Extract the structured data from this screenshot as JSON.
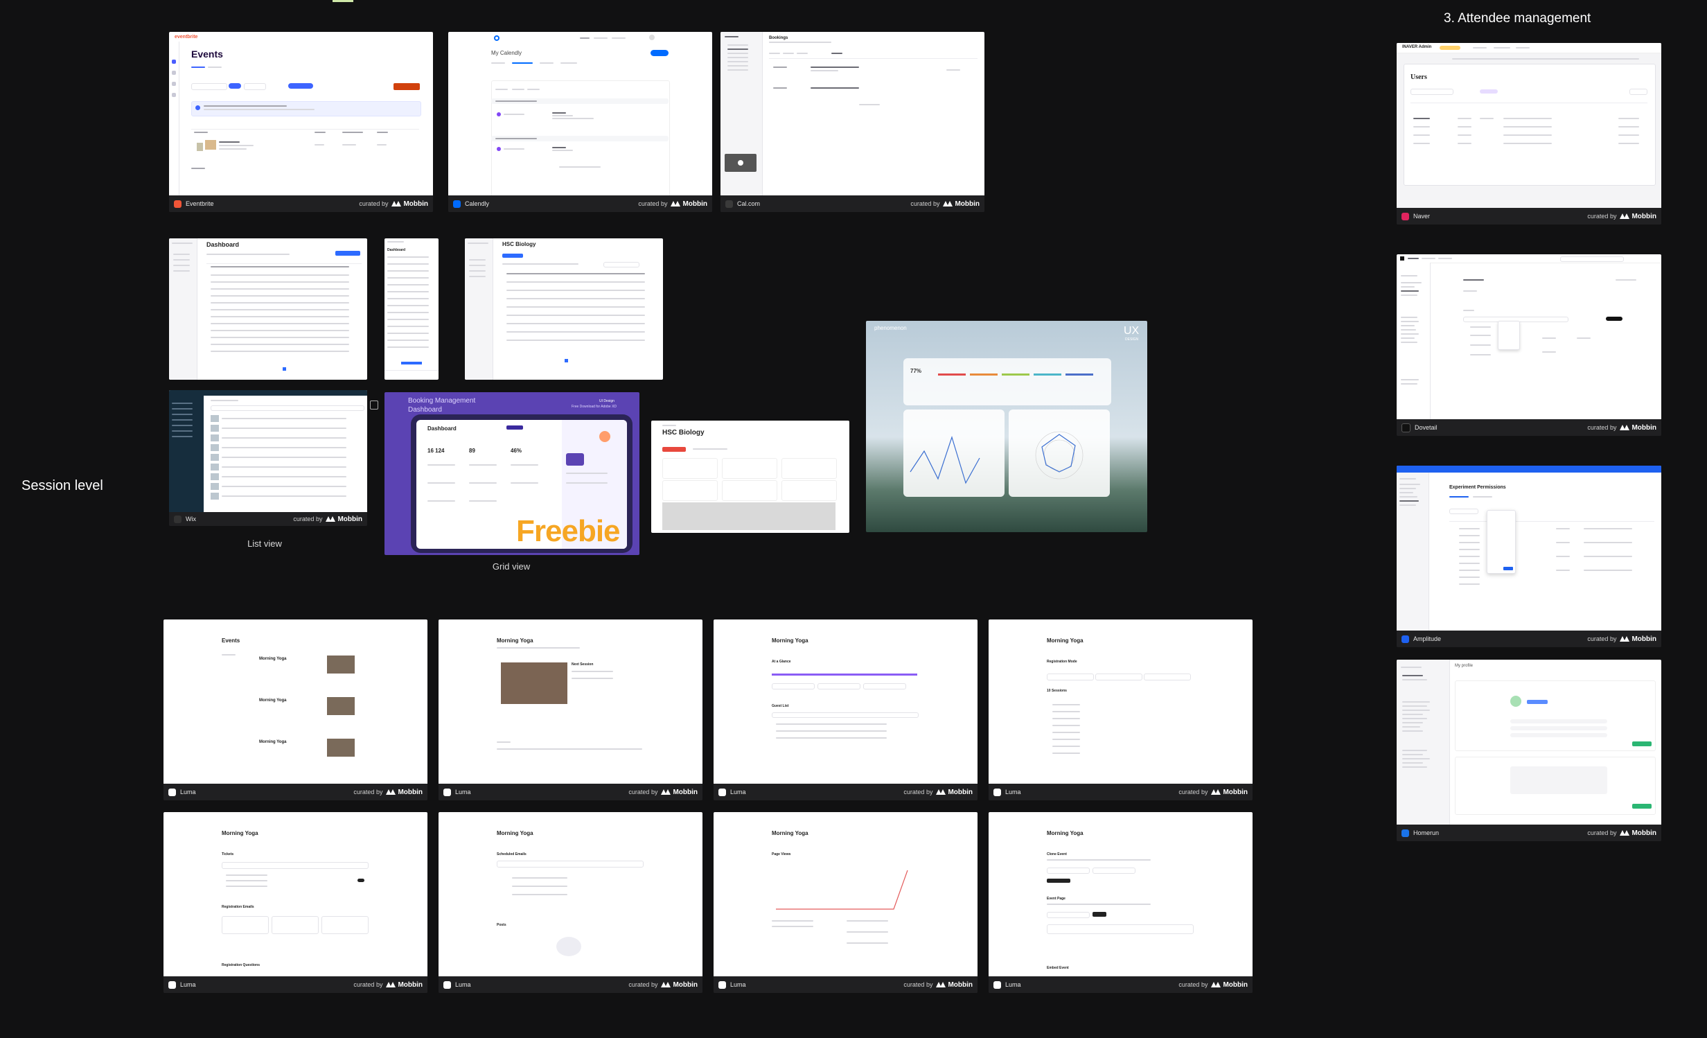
{
  "headings": {
    "attendee_management": "3. Attendee management",
    "session_level": "Session level"
  },
  "captions": {
    "list_view": "List view",
    "grid_view": "Grid view"
  },
  "footer": {
    "curated_by": "curated by",
    "brand": "Mobbin"
  },
  "cards": {
    "eventbrite": {
      "app": "Eventbrite",
      "title": "Events",
      "logo": "eventbrite",
      "app_color": "#f05537"
    },
    "calendly": {
      "app": "Calendly",
      "title": "My Calendly",
      "app_color": "#006bff"
    },
    "calcom": {
      "app": "Cal.com",
      "title": "Bookings",
      "app_color": "#292929"
    },
    "naver": {
      "app": "Naver",
      "title": "Users",
      "brand": "INAVER Admin",
      "app_color": "#e0245e"
    },
    "dovetail": {
      "app": "Dovetail",
      "app_color": "#111111"
    },
    "amplitude": {
      "app": "Amplitude",
      "title": "Experiment Permissions",
      "app_color": "#1e61f0"
    },
    "homerun": {
      "app": "Homerun",
      "title": "My profile",
      "app_color": "#1a73e8"
    },
    "dashboard_a": {
      "title": "Dashboard"
    },
    "dashboard_b": {
      "title": "Dashboard"
    },
    "hsc_a": {
      "title": "HSC Biology"
    },
    "hsc_b": {
      "title": "HSC Biology"
    },
    "wix": {
      "app": "Wix",
      "app_color": "#000000"
    },
    "booking": {
      "title": "Booking Management Dashboard",
      "inner_title": "Dashboard",
      "big_a": "16 124",
      "big_b": "89",
      "big_c": "46%",
      "freebie": "Freebie",
      "tag": "UI Design",
      "tag_sub": "Free Download for Adobe XD"
    },
    "phenomenon": {
      "brand": "phenomenon",
      "ux": "UX",
      "design": "DESIGN",
      "stat": "77%"
    },
    "luma": [
      {
        "app": "Luma",
        "title": "Events",
        "item": "Morning Yoga"
      },
      {
        "app": "Luma",
        "title": "Morning Yoga",
        "sub": "Next Session"
      },
      {
        "app": "Luma",
        "title": "Morning Yoga",
        "sub": "At a Glance",
        "sub2": "Guest List"
      },
      {
        "app": "Luma",
        "title": "Morning Yoga",
        "sub": "Registration Mode",
        "sub2": "10 Sessions"
      },
      {
        "app": "Luma",
        "title": "Morning Yoga",
        "sub": "Tickets",
        "sub2": "Registration Emails",
        "sub3": "Registration Questions"
      },
      {
        "app": "Luma",
        "title": "Morning Yoga",
        "sub": "Scheduled Emails",
        "sub2": "Posts"
      },
      {
        "app": "Luma",
        "title": "Morning Yoga",
        "sub": "Page Views"
      },
      {
        "app": "Luma",
        "title": "Morning Yoga",
        "sub": "Clone Event",
        "sub2": "Event Page",
        "sub3": "Embed Event"
      }
    ]
  }
}
